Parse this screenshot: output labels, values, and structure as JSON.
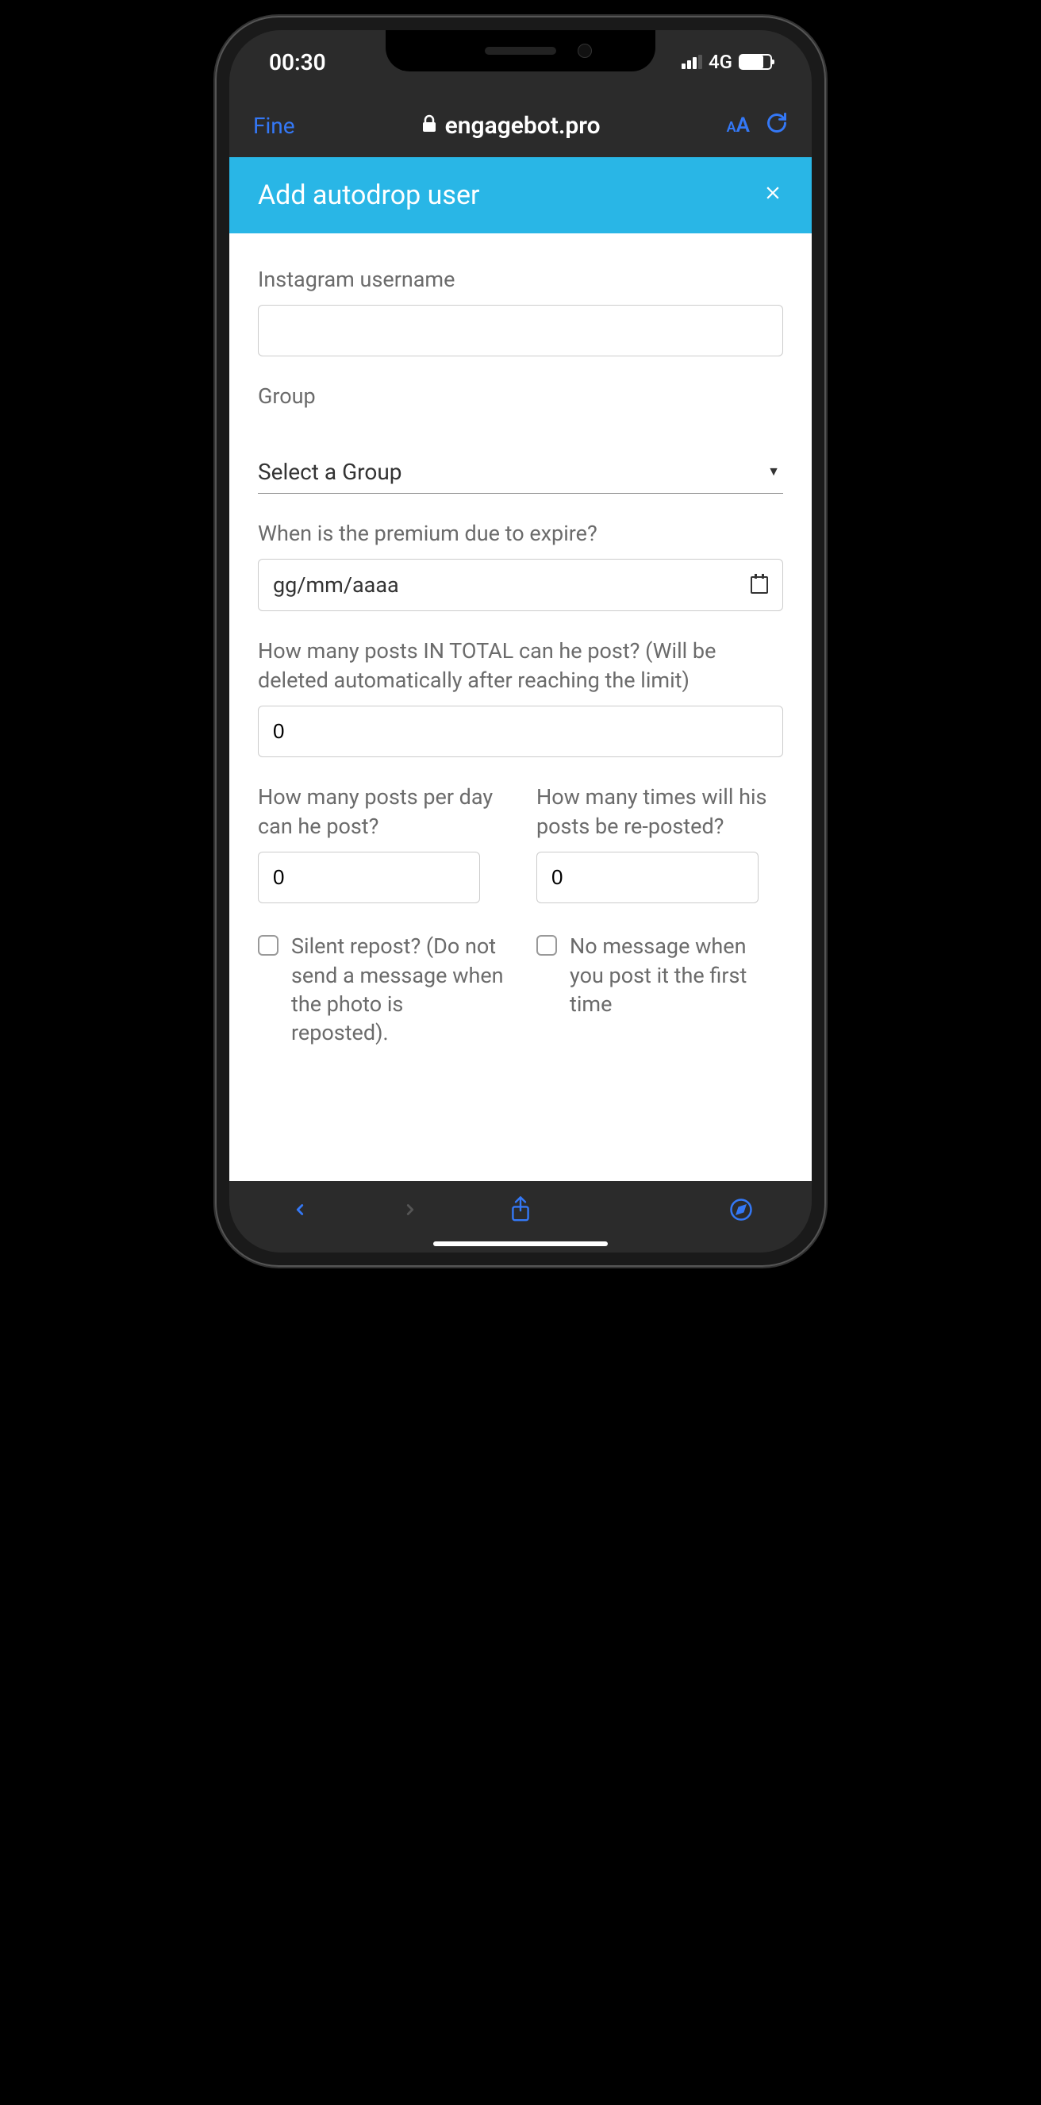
{
  "status": {
    "time": "00:30",
    "network": "4G"
  },
  "browser": {
    "back_label": "Fine",
    "domain": "engagebot.pro"
  },
  "modal": {
    "title": "Add autodrop user",
    "fields": {
      "username_label": "Instagram username",
      "group_label": "Group",
      "group_select": "Select a Group",
      "expire_label": "When is the premium due to expire?",
      "expire_placeholder": "gg/mm/aaaa",
      "total_label": "How many posts IN TOTAL can he post? (Will be deleted automatically after reaching the limit)",
      "total_value": "0",
      "perday_label": "How many posts per day can he post?",
      "perday_value": "0",
      "repost_label": "How many times will his posts be re-posted?",
      "repost_value": "0",
      "silent_label": "Silent repost? (Do not send a message when the photo is reposted).",
      "nomsg_label": "No message when you post it the first time"
    }
  }
}
